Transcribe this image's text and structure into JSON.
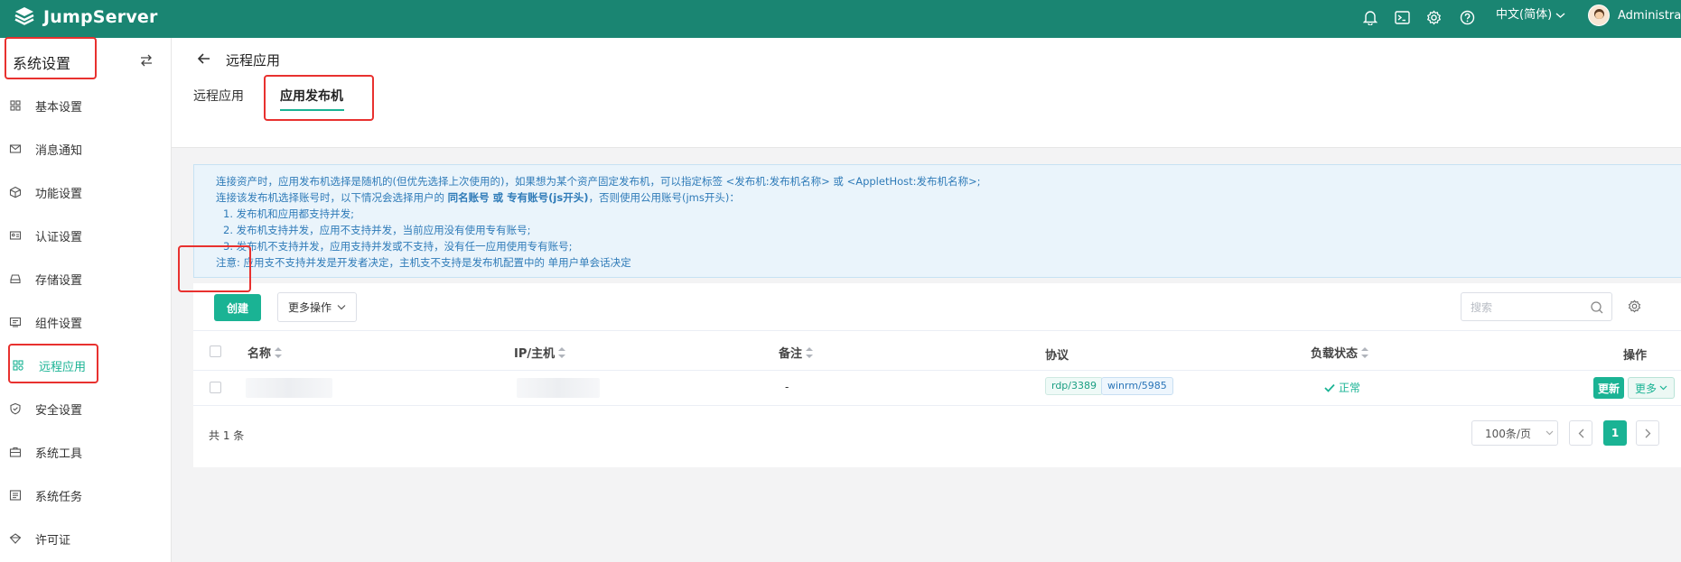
{
  "app": {
    "brand": "JumpServer",
    "language": "中文(简体)",
    "user": "Administrato"
  },
  "sidebar": {
    "title": "系统设置",
    "items": [
      {
        "label": "基本设置",
        "icon": "grid-icon"
      },
      {
        "label": "消息通知",
        "icon": "message-icon"
      },
      {
        "label": "功能设置",
        "icon": "cube-icon"
      },
      {
        "label": "认证设置",
        "icon": "id-card-icon"
      },
      {
        "label": "存储设置",
        "icon": "storage-icon"
      },
      {
        "label": "组件设置",
        "icon": "component-icon"
      },
      {
        "label": "远程应用",
        "icon": "apps-icon"
      },
      {
        "label": "安全设置",
        "icon": "shield-icon"
      },
      {
        "label": "系统工具",
        "icon": "toolbox-icon"
      },
      {
        "label": "系统任务",
        "icon": "task-icon"
      },
      {
        "label": "许可证",
        "icon": "license-icon"
      }
    ],
    "active_index": 6
  },
  "page": {
    "title": "远程应用",
    "tabs": [
      {
        "label": "远程应用"
      },
      {
        "label": "应用发布机"
      }
    ],
    "active_tab": 1
  },
  "notice": {
    "line1": "连接资产时，应用发布机选择是随机的(但优先选择上次使用的)，如果想为某个资产固定发布机，可以指定标签 <发布机:发布机名称> 或 <AppletHost:发布机名称>;",
    "line2_pre": "连接该发布机选择账号时，以下情况会选择用户的 ",
    "line2_bold": "同名账号 或 专有账号(js开头)",
    "line2_post": "，否则使用公用账号(jms开头)：",
    "item1": "1. 发布机和应用都支持并发;",
    "item2": "2. 发布机支持并发，应用不支持并发，当前应用没有使用专有账号;",
    "item3": "3. 发布机不支持并发，应用支持并发或不支持，没有任一应用使用专有账号;",
    "note": "注意: 应用支不支持并发是开发者决定，主机支不支持是发布机配置中的 单用户单会话决定"
  },
  "toolbar": {
    "create_label": "创建",
    "more_label": "更多操作",
    "search_placeholder": "搜索"
  },
  "table": {
    "headers": {
      "name": "名称",
      "ip": "IP/主机",
      "comment": "备注",
      "protocols": "协议",
      "load": "负载状态",
      "actions": "操作"
    },
    "rows": [
      {
        "comment": "-",
        "protocols": [
          "rdp/3389",
          "winrm/5985"
        ],
        "status": "正常",
        "update_label": "更新",
        "more_label": "更多"
      }
    ]
  },
  "pagination": {
    "total_text": "共 1 条",
    "page_size": "100条/页",
    "current_page": "1"
  },
  "colors": {
    "topbar": "#1a8572",
    "accent": "#1ab394",
    "highlight": "#e8312f"
  }
}
